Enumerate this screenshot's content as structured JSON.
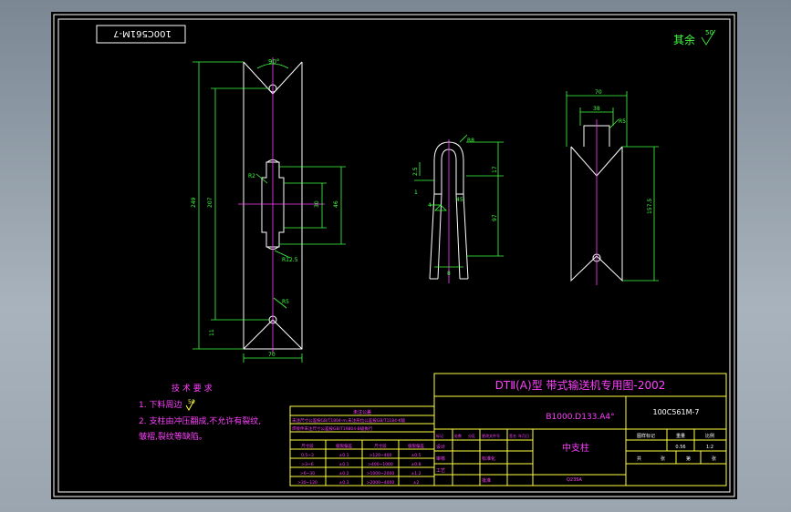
{
  "drawing_no": "100C561M-7",
  "surface_finish": {
    "label": "其余",
    "value": "50"
  },
  "title_block": {
    "title": "DTⅡ(A)型  带式输送机专用图-2002",
    "spec": "B1000.D133.A4°",
    "drawing_no": "100C561M-7",
    "part_name": "中支柱",
    "material": "Q235A",
    "scale": "1:2",
    "weight": "0.56",
    "labels": {
      "stage": "图样标记",
      "weight": "重量",
      "scale": "比例",
      "sheets": "共",
      "sheet": "张",
      "page": "第"
    },
    "change_headers": [
      "标记",
      "处数",
      "分区",
      "更改文件号",
      "签名",
      "年月日"
    ],
    "approval_labels": [
      "设计",
      "审核",
      "工艺",
      "标准化",
      "批准"
    ]
  },
  "tolerance_table": {
    "title": "未注公差",
    "note1": "未注尺寸公差按GB/T1804-m,未注形位公差按GB/T1184-K级",
    "note2": "焊接件未注尺寸公差按GB/T19804-B级执行",
    "headers": [
      "尺寸段",
      "极限偏差",
      "尺寸段",
      "极限偏差"
    ],
    "rows": [
      [
        "0.5~3",
        "±0.1",
        ">120~400",
        "±0.5"
      ],
      [
        ">3~6",
        "±0.1",
        ">400~1000",
        "±0.8"
      ],
      [
        ">6~30",
        "±0.2",
        ">1000~2000",
        "±1.2"
      ],
      [
        ">30~120",
        "±0.3",
        ">2000~4000",
        "±2"
      ]
    ]
  },
  "tech_requirements": {
    "title": "技 术 要 求",
    "items": [
      "1. 下料周边",
      "2. 支柱由冲压翻成,不允许有裂纹,",
      "   皱褶,裂纹等缺陷。"
    ],
    "roughness": "50"
  },
  "dims_front": {
    "angle": "90°",
    "total": "249",
    "inner": "207",
    "r2": "R2",
    "w30": "30",
    "w46": "46",
    "r125": "R12.5",
    "r5": "R5",
    "d11": "11",
    "width": "70"
  },
  "dims_side": {
    "r8": "R8",
    "d17": "17",
    "d25": "2.5",
    "d97": "97",
    "d45": "45",
    "d8": "8",
    "d4": "4",
    "d1": "1"
  },
  "dims_top": {
    "w70": "70",
    "w38": "38",
    "r5": "R5",
    "h157": "157.5"
  }
}
